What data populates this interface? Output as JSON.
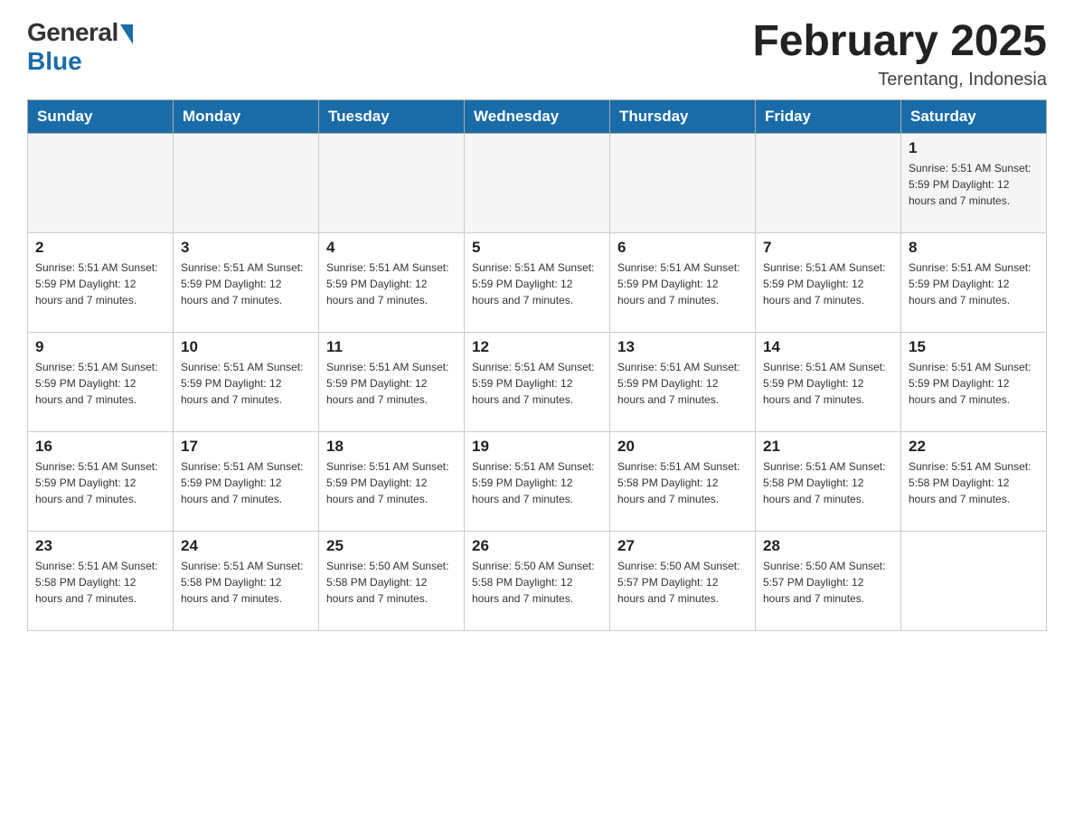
{
  "header": {
    "logo_general": "General",
    "logo_blue": "Blue",
    "month_title": "February 2025",
    "location": "Terentang, Indonesia"
  },
  "days_of_week": [
    "Sunday",
    "Monday",
    "Tuesday",
    "Wednesday",
    "Thursday",
    "Friday",
    "Saturday"
  ],
  "weeks": [
    {
      "days": [
        {
          "number": "",
          "info": ""
        },
        {
          "number": "",
          "info": ""
        },
        {
          "number": "",
          "info": ""
        },
        {
          "number": "",
          "info": ""
        },
        {
          "number": "",
          "info": ""
        },
        {
          "number": "",
          "info": ""
        },
        {
          "number": "1",
          "info": "Sunrise: 5:51 AM\nSunset: 5:59 PM\nDaylight: 12 hours\nand 7 minutes."
        }
      ]
    },
    {
      "days": [
        {
          "number": "2",
          "info": "Sunrise: 5:51 AM\nSunset: 5:59 PM\nDaylight: 12 hours\nand 7 minutes."
        },
        {
          "number": "3",
          "info": "Sunrise: 5:51 AM\nSunset: 5:59 PM\nDaylight: 12 hours\nand 7 minutes."
        },
        {
          "number": "4",
          "info": "Sunrise: 5:51 AM\nSunset: 5:59 PM\nDaylight: 12 hours\nand 7 minutes."
        },
        {
          "number": "5",
          "info": "Sunrise: 5:51 AM\nSunset: 5:59 PM\nDaylight: 12 hours\nand 7 minutes."
        },
        {
          "number": "6",
          "info": "Sunrise: 5:51 AM\nSunset: 5:59 PM\nDaylight: 12 hours\nand 7 minutes."
        },
        {
          "number": "7",
          "info": "Sunrise: 5:51 AM\nSunset: 5:59 PM\nDaylight: 12 hours\nand 7 minutes."
        },
        {
          "number": "8",
          "info": "Sunrise: 5:51 AM\nSunset: 5:59 PM\nDaylight: 12 hours\nand 7 minutes."
        }
      ]
    },
    {
      "days": [
        {
          "number": "9",
          "info": "Sunrise: 5:51 AM\nSunset: 5:59 PM\nDaylight: 12 hours\nand 7 minutes."
        },
        {
          "number": "10",
          "info": "Sunrise: 5:51 AM\nSunset: 5:59 PM\nDaylight: 12 hours\nand 7 minutes."
        },
        {
          "number": "11",
          "info": "Sunrise: 5:51 AM\nSunset: 5:59 PM\nDaylight: 12 hours\nand 7 minutes."
        },
        {
          "number": "12",
          "info": "Sunrise: 5:51 AM\nSunset: 5:59 PM\nDaylight: 12 hours\nand 7 minutes."
        },
        {
          "number": "13",
          "info": "Sunrise: 5:51 AM\nSunset: 5:59 PM\nDaylight: 12 hours\nand 7 minutes."
        },
        {
          "number": "14",
          "info": "Sunrise: 5:51 AM\nSunset: 5:59 PM\nDaylight: 12 hours\nand 7 minutes."
        },
        {
          "number": "15",
          "info": "Sunrise: 5:51 AM\nSunset: 5:59 PM\nDaylight: 12 hours\nand 7 minutes."
        }
      ]
    },
    {
      "days": [
        {
          "number": "16",
          "info": "Sunrise: 5:51 AM\nSunset: 5:59 PM\nDaylight: 12 hours\nand 7 minutes."
        },
        {
          "number": "17",
          "info": "Sunrise: 5:51 AM\nSunset: 5:59 PM\nDaylight: 12 hours\nand 7 minutes."
        },
        {
          "number": "18",
          "info": "Sunrise: 5:51 AM\nSunset: 5:59 PM\nDaylight: 12 hours\nand 7 minutes."
        },
        {
          "number": "19",
          "info": "Sunrise: 5:51 AM\nSunset: 5:59 PM\nDaylight: 12 hours\nand 7 minutes."
        },
        {
          "number": "20",
          "info": "Sunrise: 5:51 AM\nSunset: 5:58 PM\nDaylight: 12 hours\nand 7 minutes."
        },
        {
          "number": "21",
          "info": "Sunrise: 5:51 AM\nSunset: 5:58 PM\nDaylight: 12 hours\nand 7 minutes."
        },
        {
          "number": "22",
          "info": "Sunrise: 5:51 AM\nSunset: 5:58 PM\nDaylight: 12 hours\nand 7 minutes."
        }
      ]
    },
    {
      "days": [
        {
          "number": "23",
          "info": "Sunrise: 5:51 AM\nSunset: 5:58 PM\nDaylight: 12 hours\nand 7 minutes."
        },
        {
          "number": "24",
          "info": "Sunrise: 5:51 AM\nSunset: 5:58 PM\nDaylight: 12 hours\nand 7 minutes."
        },
        {
          "number": "25",
          "info": "Sunrise: 5:50 AM\nSunset: 5:58 PM\nDaylight: 12 hours\nand 7 minutes."
        },
        {
          "number": "26",
          "info": "Sunrise: 5:50 AM\nSunset: 5:58 PM\nDaylight: 12 hours\nand 7 minutes."
        },
        {
          "number": "27",
          "info": "Sunrise: 5:50 AM\nSunset: 5:57 PM\nDaylight: 12 hours\nand 7 minutes."
        },
        {
          "number": "28",
          "info": "Sunrise: 5:50 AM\nSunset: 5:57 PM\nDaylight: 12 hours\nand 7 minutes."
        },
        {
          "number": "",
          "info": ""
        }
      ]
    }
  ]
}
